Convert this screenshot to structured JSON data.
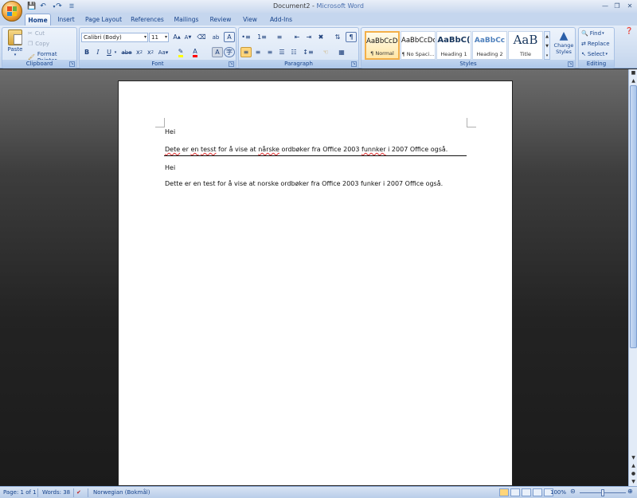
{
  "window": {
    "doc_title": "Document2",
    "separator": " - ",
    "app_title": "Microsoft Word"
  },
  "qat": {
    "save_icon": "save-icon",
    "undo_icon": "undo-icon",
    "redo_icon": "redo-icon",
    "customize": "customize-icon"
  },
  "tabs": [
    "Home",
    "Insert",
    "Page Layout",
    "References",
    "Mailings",
    "Review",
    "View",
    "Add-Ins"
  ],
  "clipboard": {
    "label": "Clipboard",
    "paste": "Paste",
    "cut": "Cut",
    "copy": "Copy",
    "format_painter": "Format Painter"
  },
  "font": {
    "label": "Font",
    "family": "Calibri (Body)",
    "size": "11"
  },
  "paragraph": {
    "label": "Paragraph"
  },
  "styles": {
    "label": "Styles",
    "items": [
      {
        "preview": "AaBbCcDc",
        "name": "¶ Normal"
      },
      {
        "preview": "AaBbCcDc",
        "name": "¶ No Spaci..."
      },
      {
        "preview": "AaBbC(",
        "name": "Heading 1"
      },
      {
        "preview": "AaBbCc",
        "name": "Heading 2"
      },
      {
        "preview": "AaB",
        "name": "Title"
      }
    ],
    "change_styles": "Change Styles"
  },
  "editing": {
    "label": "Editing",
    "find": "Find",
    "replace": "Replace",
    "select": "Select"
  },
  "document": {
    "line1": "Hei",
    "line2": [
      {
        "t": "Dete",
        "s": true
      },
      {
        "t": " er ",
        "s": false
      },
      {
        "t": "en",
        "s": true
      },
      {
        "t": " ",
        "s": false
      },
      {
        "t": "tesst",
        "s": true
      },
      {
        "t": " for å vise at ",
        "s": false
      },
      {
        "t": "nårske",
        "s": true
      },
      {
        "t": " ordbøker fra Office 2003  ",
        "s": false
      },
      {
        "t": "funnker",
        "s": true
      },
      {
        "t": " i 2007  Office også.",
        "s": false
      }
    ],
    "line3": "Hei",
    "line4": "Dette er en test for å vise at norske ordbøker fra Office 2003  funker i 2007  Office også."
  },
  "status": {
    "page": "Page: 1 of 1",
    "words": "Words: 38",
    "language": "Norwegian (Bokmål)",
    "zoom": "100%",
    "zoom_level": 1.0
  },
  "colors": {
    "highlight": "#ffff00",
    "font_color": "#ff0000",
    "spell_underline": "#e03030"
  }
}
